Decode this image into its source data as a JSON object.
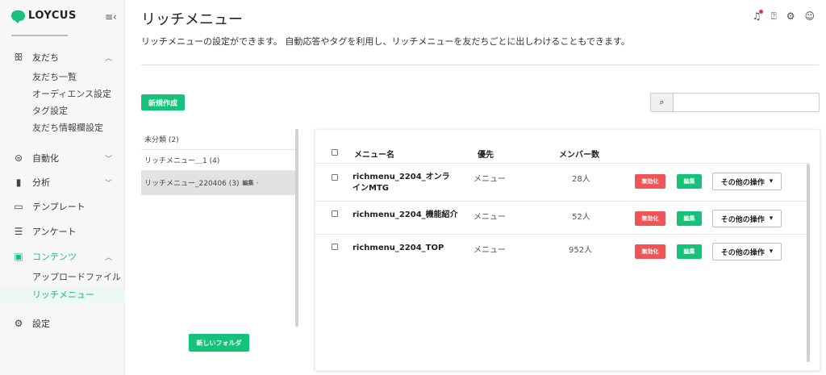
{
  "brand": {
    "name": "LOYCUS",
    "color": "#14c27a"
  },
  "sidebar": {
    "items": [
      {
        "label": "友だち",
        "icon": "friends-icon",
        "expanded": true,
        "children": [
          "友だち一覧",
          "オーディエンス設定",
          "タグ設定",
          "友だち情報欄設定"
        ]
      },
      {
        "label": "自動化",
        "icon": "robot-icon",
        "expanded": false
      },
      {
        "label": "分析",
        "icon": "bar-chart-icon",
        "expanded": false
      },
      {
        "label": "テンプレート",
        "icon": "template-icon"
      },
      {
        "label": "アンケート",
        "icon": "survey-icon"
      },
      {
        "label": "コンテンツ",
        "icon": "image-icon",
        "expanded": true,
        "active": true,
        "children": [
          "アップロードファイル",
          "リッチメニュー"
        ]
      },
      {
        "label": "設定",
        "icon": "gear-icon"
      }
    ],
    "active_child": "リッチメニュー"
  },
  "header": {
    "title": "リッチメニュー",
    "description": "リッチメニューの設定ができます。 自動応答やタグを利用し、リッチメニューを友だちごとに出しわけることもできます。"
  },
  "toolbar": {
    "new_label": "新規作成",
    "search_placeholder": ""
  },
  "folders": {
    "items": [
      {
        "label": "未分類 (2)"
      },
      {
        "label": "リッチメニュー＿1 (4)"
      },
      {
        "label": "リッチメニュー_220406 (3)",
        "edit": "編集",
        "selected": true
      }
    ],
    "new_folder_label": "新しいフォルダ"
  },
  "table": {
    "columns": [
      "メニュー名",
      "優先",
      "メンバー数"
    ],
    "rows": [
      {
        "name": "richmenu_2204_オンラインMTG",
        "priority": "メニュー",
        "members": "28人"
      },
      {
        "name": "richmenu_2204_機能紹介",
        "priority": "メニュー",
        "members": "52人"
      },
      {
        "name": "richmenu_2204_TOP",
        "priority": "メニュー",
        "members": "952人"
      }
    ],
    "disable_label": "無効化",
    "edit_label": "編集",
    "more_label": "その他の操作"
  }
}
